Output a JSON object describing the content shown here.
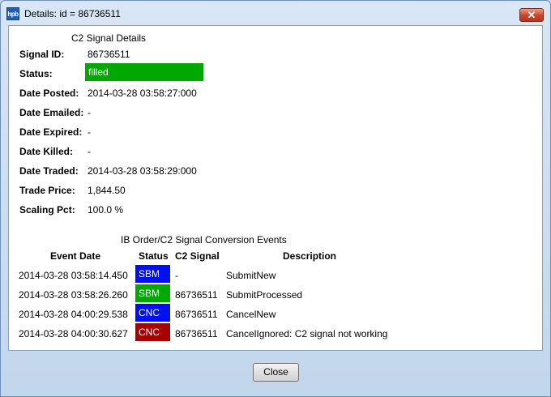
{
  "window": {
    "title": "Details: id = 86736511",
    "icon_text": "hpb",
    "close_glyph": "✕"
  },
  "signal_details": {
    "heading": "C2 Signal Details",
    "fields": [
      {
        "label": "Signal ID:",
        "value": "86736511"
      },
      {
        "label": "Status:",
        "value": "filled",
        "color": "#00a800"
      },
      {
        "label": "Date Posted:",
        "value": "2014-03-28 03:58:27:000"
      },
      {
        "label": "Date Emailed:",
        "value": "-"
      },
      {
        "label": "Date Expired:",
        "value": "-"
      },
      {
        "label": "Date Killed:",
        "value": "-"
      },
      {
        "label": "Date Traded:",
        "value": "2014-03-28 03:58:29:000"
      },
      {
        "label": "Trade Price:",
        "value": "1,844.50"
      },
      {
        "label": "Scaling Pct:",
        "value": "100.0 %"
      }
    ]
  },
  "events": {
    "heading": "IB Order/C2 Signal Conversion Events",
    "columns": [
      "Event Date",
      "Status",
      "C2 Signal",
      "Description"
    ],
    "rows": [
      {
        "date": "2014-03-28 03:58:14.450",
        "status": "SBM",
        "status_color": "#0010ee",
        "signal": "-",
        "description": "SubmitNew"
      },
      {
        "date": "2014-03-28 03:58:26.260",
        "status": "SBM",
        "status_color": "#00a800",
        "signal": "86736511",
        "description": "SubmitProcessed"
      },
      {
        "date": "2014-03-28 04:00:29.538",
        "status": "CNC",
        "status_color": "#0010ee",
        "signal": "86736511",
        "description": "CancelNew"
      },
      {
        "date": "2014-03-28 04:00:30.627",
        "status": "CNC",
        "status_color": "#a80000",
        "signal": "86736511",
        "description": "CancelIgnored: C2 signal not working"
      }
    ]
  },
  "buttons": {
    "close_label": "Close"
  }
}
